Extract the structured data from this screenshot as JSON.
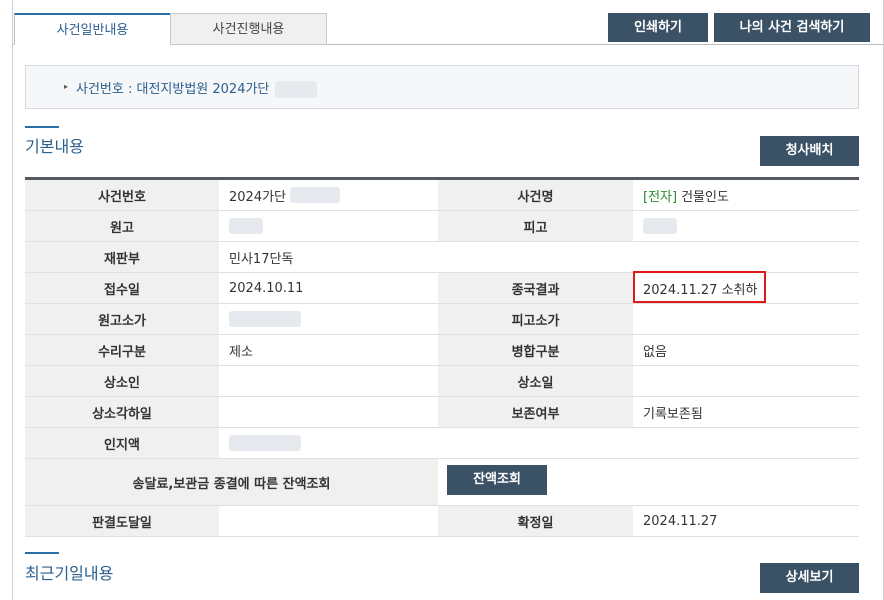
{
  "tabs": [
    {
      "label": "사건일반내용",
      "active": true
    },
    {
      "label": "사건진행내용",
      "active": false
    }
  ],
  "toolbar": {
    "print_label": "인쇄하기",
    "search_label": "나의 사건 검색하기"
  },
  "case_header": {
    "text": "사건번호 : 대전지방법원 2024가단"
  },
  "basic_section": {
    "title": "기본내용",
    "dispatch_button": "청사배치"
  },
  "rows": [
    {
      "l_label": "사건번호",
      "l_value": "2024가단",
      "r_label": "사건명",
      "r_tag": "[전자]",
      "r_value": "건물인도"
    },
    {
      "l_label": "원고",
      "l_value": "",
      "r_label": "피고",
      "r_value": ""
    },
    {
      "l_label": "재판부",
      "l_value": "민사17단독"
    },
    {
      "l_label": "접수일",
      "l_value": "2024.10.11",
      "r_label": "종국결과",
      "r_value": "2024.11.27 소취하"
    },
    {
      "l_label": "원고소가",
      "l_value": "",
      "r_label": "피고소가",
      "r_value": ""
    },
    {
      "l_label": "수리구분",
      "l_value": "제소",
      "r_label": "병합구분",
      "r_value": "없음"
    },
    {
      "l_label": "상소인",
      "l_value": "",
      "r_label": "상소일",
      "r_value": ""
    },
    {
      "l_label": "상소각하일",
      "l_value": "",
      "r_label": "보존여부",
      "r_value": "기록보존됨"
    },
    {
      "l_label": "인지액",
      "l_value": ""
    },
    {
      "l_label": "송달료,보관금 종결에 따른 잔액조회",
      "button": "잔액조회"
    },
    {
      "l_label": "판결도달일",
      "l_value": "",
      "r_label": "확정일",
      "r_value": "2024.11.27"
    }
  ],
  "recent_section": {
    "title": "최근기일내용",
    "detail_button": "상세보기"
  }
}
